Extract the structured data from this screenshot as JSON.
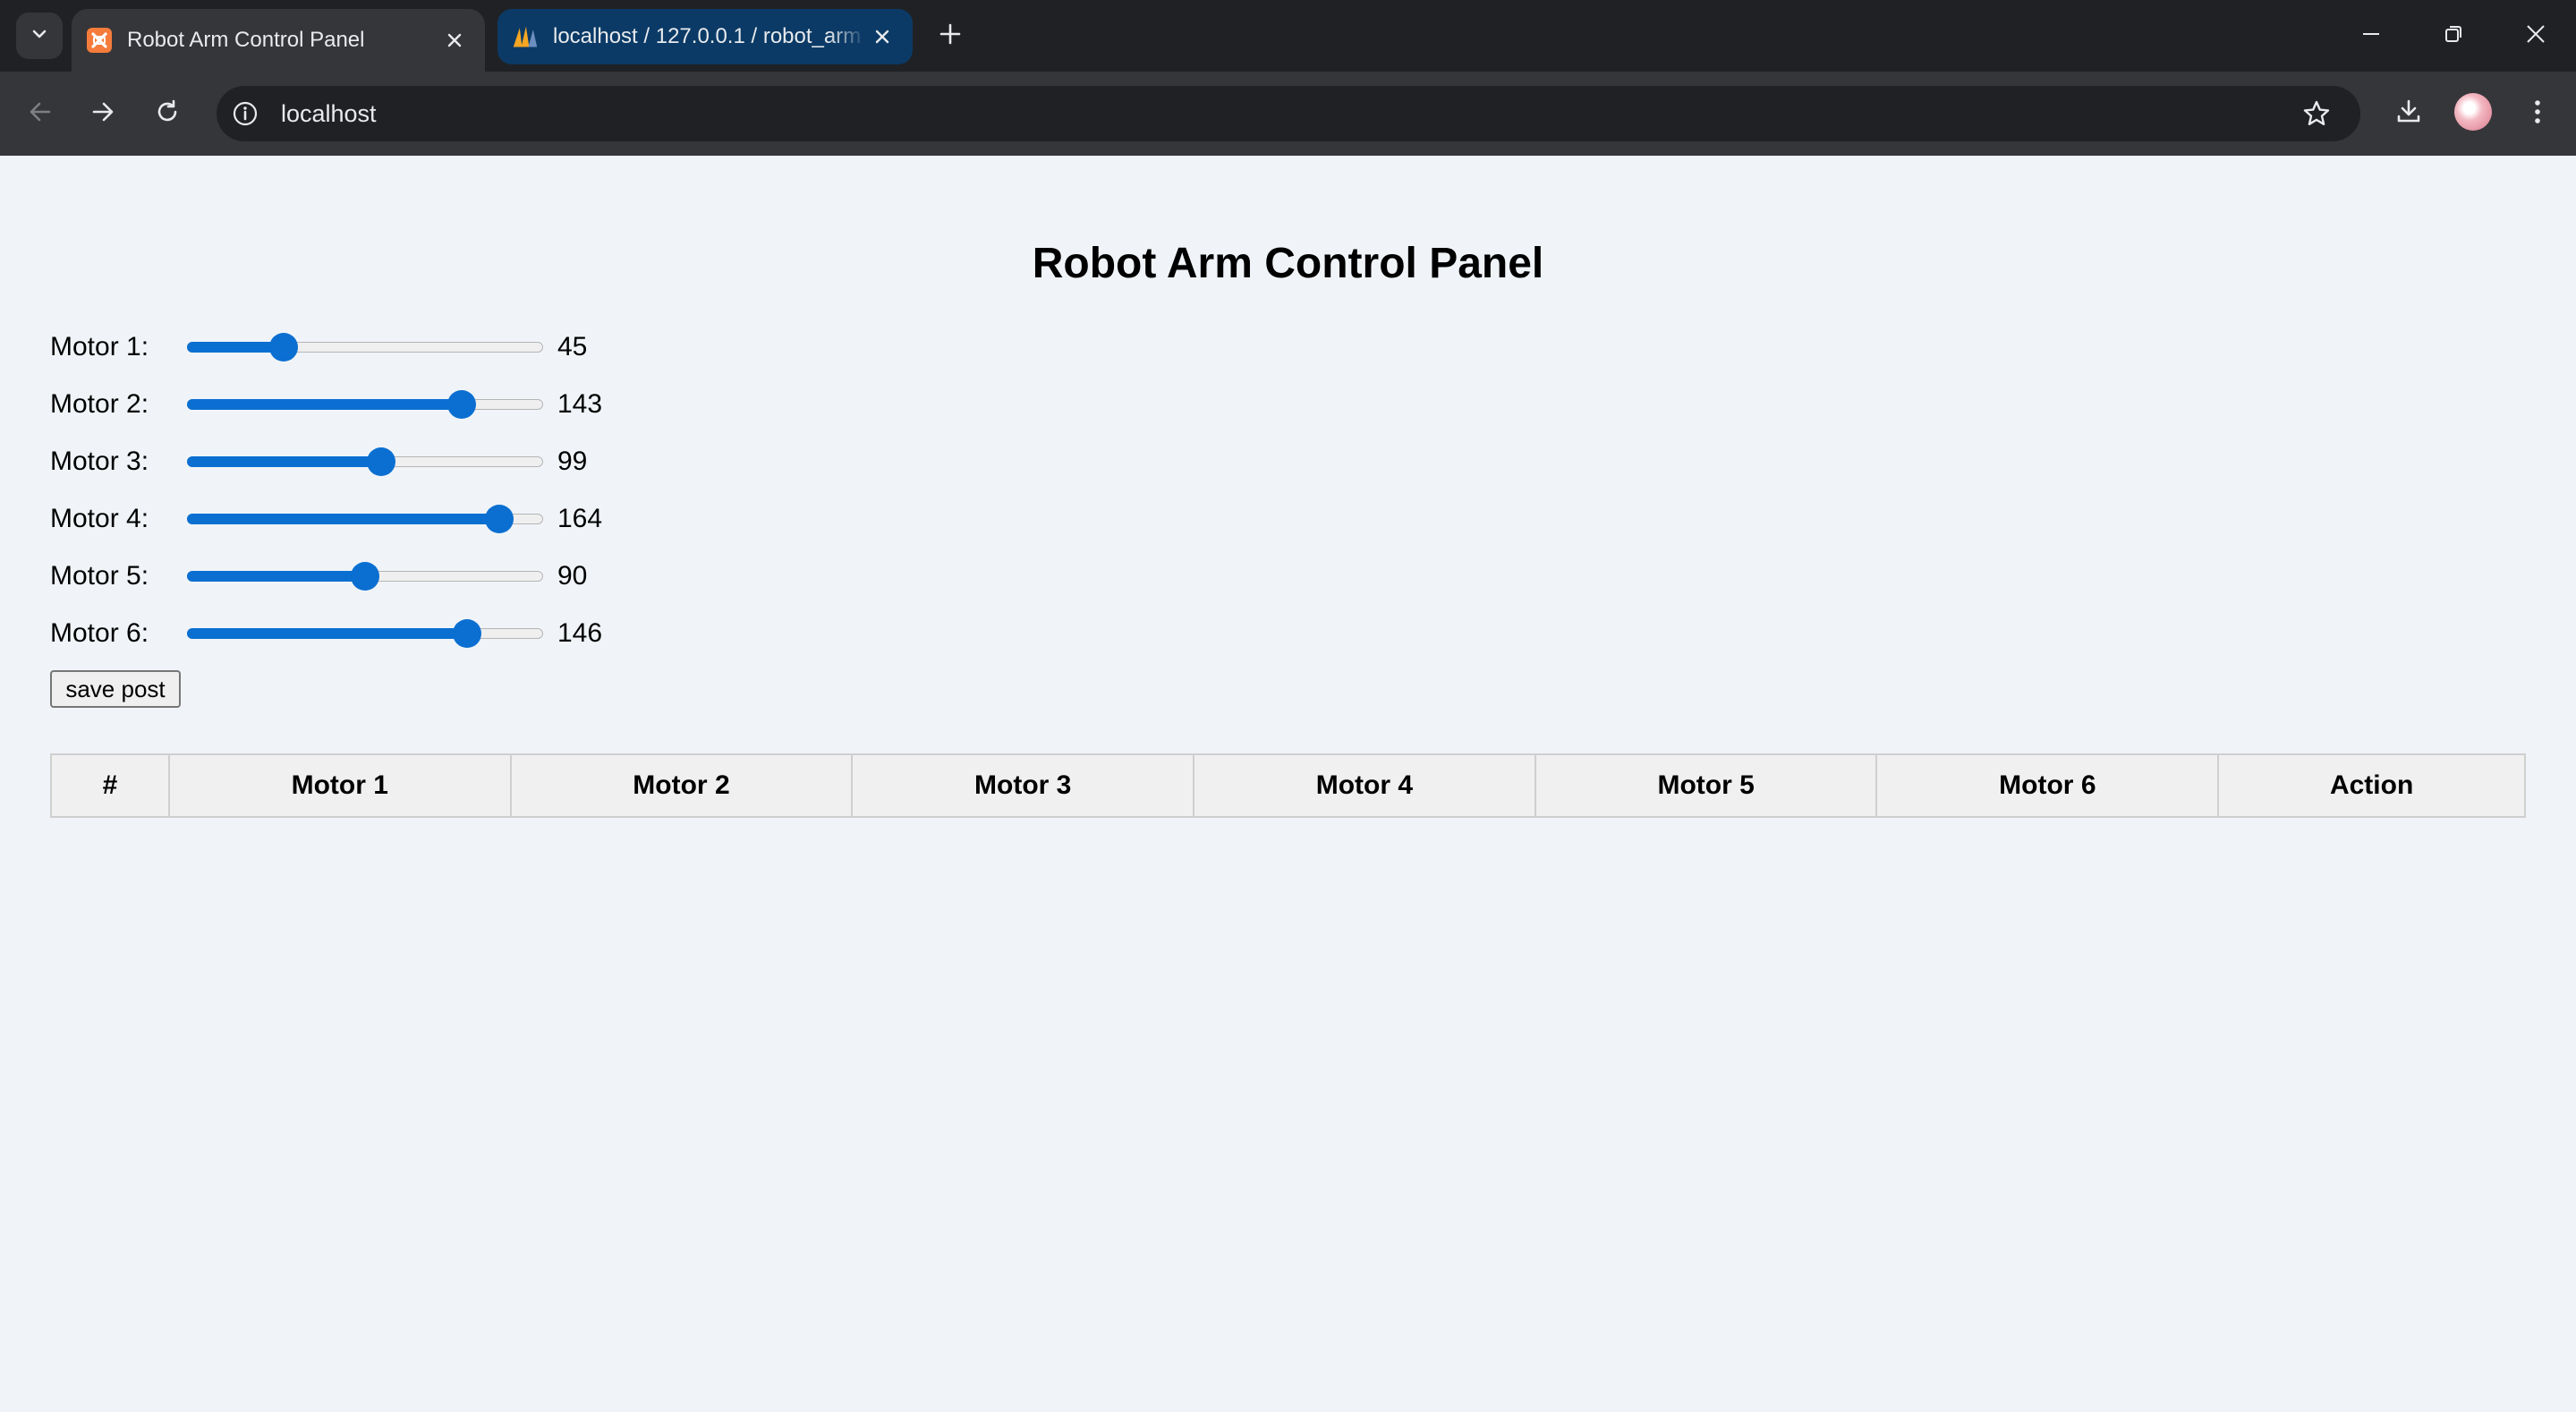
{
  "browser": {
    "tabs": [
      {
        "title": "Robot Arm Control Panel",
        "favicon": "xampp-icon",
        "active": true
      },
      {
        "title": "localhost / 127.0.0.1 / robot_arm",
        "favicon": "phpmyadmin-icon",
        "active": false
      }
    ],
    "address": "localhost"
  },
  "page": {
    "title": "Robot Arm Control Panel",
    "range": {
      "min": 0,
      "max": 180
    },
    "motors": [
      {
        "label": "Motor 1:",
        "value": 45
      },
      {
        "label": "Motor 2:",
        "value": 143
      },
      {
        "label": "Motor 3:",
        "value": 99
      },
      {
        "label": "Motor 4:",
        "value": 164
      },
      {
        "label": "Motor 5:",
        "value": 90
      },
      {
        "label": "Motor 6:",
        "value": 146
      }
    ],
    "save_button": "save post",
    "table": {
      "columns": [
        "#",
        "Motor 1",
        "Motor 2",
        "Motor 3",
        "Motor 4",
        "Motor 5",
        "Motor 6",
        "Action"
      ],
      "rows": []
    }
  },
  "colors": {
    "accent": "#0b6fd1",
    "page_bg": "#f0f4f8",
    "chrome_dark": "#202124",
    "chrome_toolbar": "#35363a"
  }
}
